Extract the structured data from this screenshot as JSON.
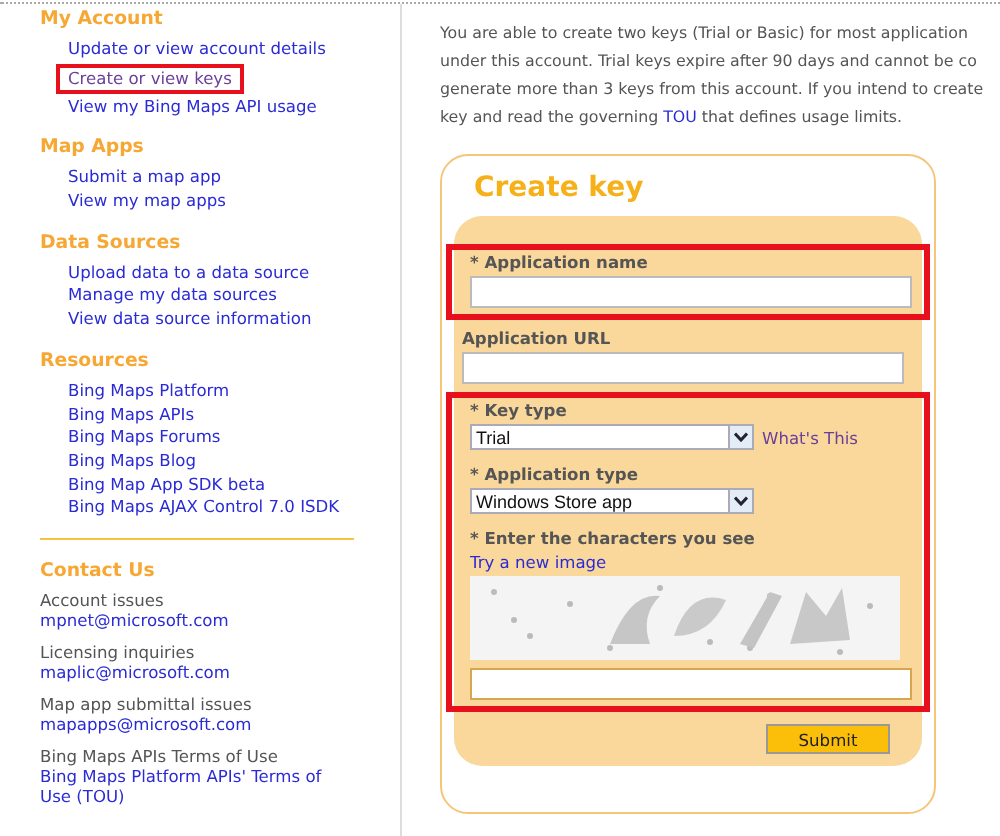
{
  "sidebar": {
    "sections": [
      {
        "heading": "My Account",
        "items": [
          {
            "label": "Update or view account details",
            "highlighted": false
          },
          {
            "label": "Create or view keys",
            "highlighted": true
          },
          {
            "label": "View my Bing Maps API usage",
            "highlighted": false
          }
        ]
      },
      {
        "heading": "Map Apps",
        "items": [
          {
            "label": "Submit a map app",
            "highlighted": false
          },
          {
            "label": "View my map apps",
            "highlighted": false
          }
        ]
      },
      {
        "heading": "Data Sources",
        "items": [
          {
            "label": "Upload data to a data source",
            "highlighted": false
          },
          {
            "label": "Manage my data sources",
            "highlighted": false
          },
          {
            "label": "View data source information",
            "highlighted": false
          }
        ]
      },
      {
        "heading": "Resources",
        "items": [
          {
            "label": "Bing Maps Platform",
            "highlighted": false
          },
          {
            "label": "Bing Maps APIs",
            "highlighted": false
          },
          {
            "label": "Bing Maps Forums",
            "highlighted": false
          },
          {
            "label": "Bing Maps Blog",
            "highlighted": false
          },
          {
            "label": "Bing Map App SDK beta",
            "highlighted": false
          },
          {
            "label": "Bing Maps AJAX Control 7.0 ISDK",
            "highlighted": false
          }
        ]
      }
    ],
    "contact": {
      "heading": "Contact Us",
      "entries": [
        {
          "label": "Account issues",
          "link": "mpnet@microsoft.com"
        },
        {
          "label": "Licensing inquiries",
          "link": "maplic@microsoft.com"
        },
        {
          "label": "Map app submittal issues",
          "link": "mapapps@microsoft.com"
        },
        {
          "label": "Bing Maps APIs Terms of Use",
          "link": "Bing Maps Platform APIs' Terms of Use (TOU)"
        }
      ]
    }
  },
  "intro": [
    [
      {
        "kind": "text",
        "text": "You are able to create two keys (Trial or Basic) for most application"
      }
    ],
    [
      {
        "kind": "text",
        "text": "under this account. Trial keys expire after 90 days and cannot be co"
      }
    ],
    [
      {
        "kind": "text",
        "text": "generate more than 3 keys from this account. If you intend to create"
      }
    ],
    [
      {
        "kind": "text",
        "text": "key and read the governing "
      },
      {
        "kind": "link",
        "text": "TOU"
      },
      {
        "kind": "text",
        "text": " that defines usage limits."
      }
    ]
  ],
  "form": {
    "title": "Create key",
    "groups": [
      {
        "highlighted": true,
        "fields": [
          {
            "kind": "text",
            "label": "* Application name"
          }
        ]
      },
      {
        "highlighted": false,
        "fields": [
          {
            "kind": "text",
            "label": "Application URL"
          }
        ]
      },
      {
        "highlighted": true,
        "fields": [
          {
            "kind": "select",
            "label": "* Key type",
            "value": "Trial",
            "help": "What's This"
          },
          {
            "kind": "select",
            "label": "* Application type",
            "value": "Windows Store app"
          },
          {
            "kind": "captcha",
            "label": "* Enter the characters you see",
            "refresh": "Try a new image"
          }
        ]
      }
    ],
    "submit": "Submit"
  }
}
